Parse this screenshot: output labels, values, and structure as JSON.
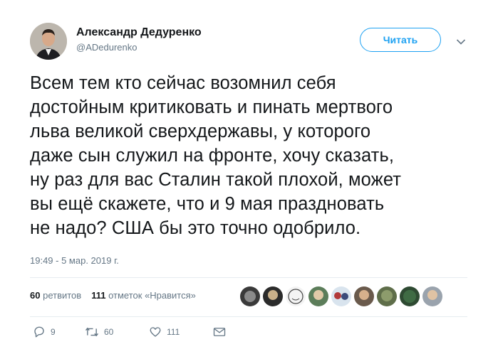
{
  "author": {
    "name": "Александр Дедуренко",
    "handle": "@ADedurenko"
  },
  "follow_label": "Читать",
  "tweet_lines": [
    "Всем тем кто сейчас возомнил себя",
    "достойным критиковать и пинать мертвого",
    "льва великой сверхдержавы, у которого",
    "даже сын служил на фронте, хочу сказать,",
    "ну раз для вас Сталин такой плохой, может",
    "вы ещё скажете, что и 9 мая праздновать",
    "не надо? США бы это точно одобрило."
  ],
  "timestamp": "19:49 - 5 мар. 2019 г.",
  "stats": {
    "retweets_count": "60",
    "retweets_label": "ретвитов",
    "likes_count": "111",
    "likes_label": "отметок «Нравится»"
  },
  "actions": {
    "reply_count": "9",
    "retweet_count": "60",
    "like_count": "111"
  },
  "colors": {
    "accent": "#1da1f2",
    "muted": "#657786",
    "text": "#14171a",
    "divider": "#e6ecf0"
  },
  "icons": [
    "chevron-down-icon",
    "reply-icon",
    "retweet-icon",
    "heart-icon",
    "message-icon"
  ]
}
